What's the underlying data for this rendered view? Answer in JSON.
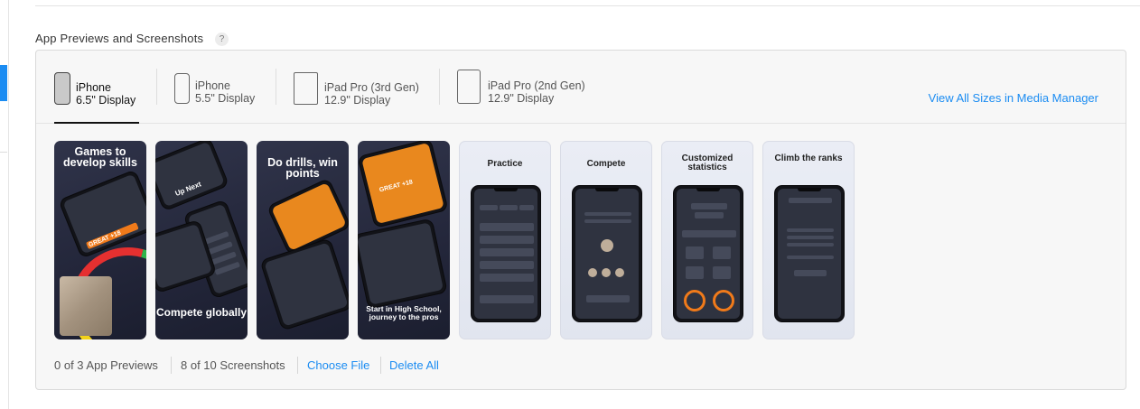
{
  "section": {
    "title": "App Previews and Screenshots",
    "help": "?"
  },
  "tabs": [
    {
      "line1": "iPhone",
      "line2": "6.5\" Display",
      "active": true
    },
    {
      "line1": "iPhone",
      "line2": "5.5\" Display",
      "active": false
    },
    {
      "line1": "iPad Pro (3rd Gen)",
      "line2": "12.9\" Display",
      "active": false
    },
    {
      "line1": "iPad Pro (2nd Gen)",
      "line2": "12.9\" Display",
      "active": false
    }
  ],
  "view_all_link": "View All Sizes in Media Manager",
  "screenshots": [
    {
      "headline_top": "Games to develop skills",
      "headline_bottom": "",
      "banner": "GREAT +18"
    },
    {
      "headline_top": "",
      "headline_bottom": "Compete globally",
      "banner": "Up Next"
    },
    {
      "headline_top": "Do drills, win points",
      "headline_bottom": "",
      "banner": ""
    },
    {
      "headline_top": "",
      "headline_bottom": "Start in High School, journey to the pros",
      "banner": "GREAT +18"
    },
    {
      "headline_top": "Practice",
      "headline_bottom": ""
    },
    {
      "headline_top": "Compete",
      "headline_bottom": ""
    },
    {
      "headline_top": "Customized statistics",
      "headline_bottom": ""
    },
    {
      "headline_top": "Climb the ranks",
      "headline_bottom": ""
    }
  ],
  "footer": {
    "previews": "0 of 3 App Previews",
    "screenshots": "8 of 10 Screenshots",
    "choose_file": "Choose File",
    "delete_all": "Delete All"
  },
  "colors": {
    "accent": "#1b8cf2",
    "brand_orange": "#f07a1a",
    "dark_card": "#2a2d40"
  }
}
